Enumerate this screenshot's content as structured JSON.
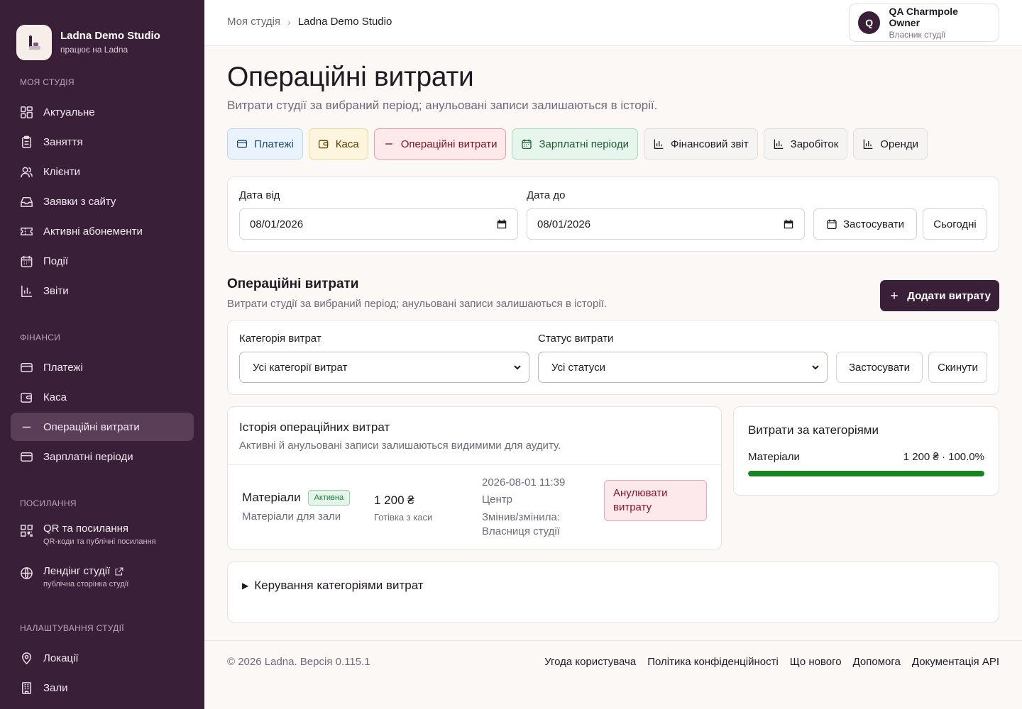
{
  "brand": {
    "name": "Ladna Demo Studio",
    "sub": "працює на Ladna"
  },
  "sidebar": {
    "sections": [
      {
        "title": "Моя студія",
        "items": [
          "Актуальне",
          "Заняття",
          "Клієнти",
          "Заявки з сайту",
          "Активні абонементи",
          "Події",
          "Звіти"
        ]
      },
      {
        "title": "Фінанси",
        "items": [
          "Платежі",
          "Каса",
          "Операційні витрати",
          "Зарплатні періоди"
        ]
      },
      {
        "title": "Посилання",
        "items": [
          {
            "label": "QR та посилання",
            "sub": "QR-коди та публічні посилання"
          },
          {
            "label": "Лендінг студії",
            "sub": "публічна сторінка студії"
          }
        ]
      },
      {
        "title": "Налаштування студії",
        "items": [
          "Локації",
          "Зали"
        ]
      }
    ],
    "active": "Операційні витрати"
  },
  "breadcrumb": {
    "parent": "Моя студія",
    "current": "Ladna Demo Studio"
  },
  "user": {
    "initial": "Q",
    "name": "QA Charmpole Owner",
    "role": "Власник студії"
  },
  "page": {
    "title": "Операційні витрати",
    "subtitle": "Витрати студії за вибраний період; анульовані записи залишаються в історії."
  },
  "tabs": [
    "Платежі",
    "Каса",
    "Операційні витрати",
    "Зарплатні періоди",
    "Фінансовий звіт",
    "Заробіток",
    "Оренди"
  ],
  "date_filter": {
    "from_label": "Дата від",
    "from_value": "08/01/2026",
    "to_label": "Дата до",
    "to_value": "08/01/2026",
    "apply": "Застосувати",
    "today": "Сьогодні"
  },
  "section": {
    "title": "Операційні витрати",
    "subtitle": "Витрати студії за вибраний період; анульовані записи залишаються в історії.",
    "add_button": "Додати витрату"
  },
  "filters": {
    "category_label": "Категорія витрат",
    "category_value": "Усі категорії витрат",
    "status_label": "Статус витрати",
    "status_value": "Усі статуси",
    "apply": "Застосувати",
    "reset": "Скинути"
  },
  "history": {
    "title": "Історія операційних витрат",
    "subtitle": "Активні й анульовані записи залишаються видимими для аудиту.",
    "rows": [
      {
        "category": "Матеріали",
        "status": "Активна",
        "description": "Матеріали для зали",
        "amount": "1 200 ₴",
        "method": "Готівка з каси",
        "datetime": "2026-08-01 11:39",
        "location": "Центр",
        "changed_by": "Змінив/змінила: Власниця студії",
        "cancel": "Анулювати витрату"
      }
    ]
  },
  "by_category": {
    "title": "Витрати за категоріями",
    "items": [
      {
        "name": "Матеріали",
        "value": "1 200 ₴ · 100.0%",
        "share": 1.0
      }
    ]
  },
  "categories_manage": {
    "label": "Керування категоріями витрат"
  },
  "footer": {
    "copy": "© 2026 Ladna. Версія 0.115.1",
    "links": [
      "Угода користувача",
      "Політика конфіденційності",
      "Що нового",
      "Допомога",
      "Документація API"
    ]
  }
}
